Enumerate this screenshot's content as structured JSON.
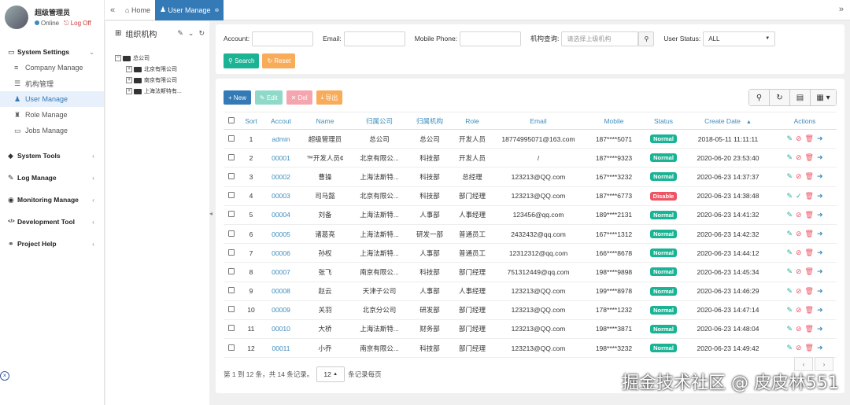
{
  "user": {
    "name": "超级管理员",
    "online": "Online",
    "logoff": "Log Off"
  },
  "menu": [
    {
      "label": "System Settings",
      "icon": "monitor-icon",
      "glyph": "▭",
      "arrow": "⌄"
    },
    {
      "label": "System Tools",
      "icon": "cube-icon",
      "glyph": "◆",
      "arrow": "‹"
    },
    {
      "label": "Log Manage",
      "icon": "edit-icon",
      "glyph": "✎",
      "arrow": "‹"
    },
    {
      "label": "Monitoring Manage",
      "icon": "eye-icon",
      "glyph": "◉",
      "arrow": "‹"
    },
    {
      "label": "Development Tool",
      "icon": "code-icon",
      "glyph": "</>",
      "arrow": "‹"
    },
    {
      "label": "Project Help",
      "icon": "link-icon",
      "glyph": "⚭",
      "arrow": "‹"
    }
  ],
  "submenu": [
    {
      "label": "Company Manage",
      "glyph": "≡"
    },
    {
      "label": "机构管理",
      "glyph": "☰"
    },
    {
      "label": "User Manage",
      "glyph": "♟"
    },
    {
      "label": "Role Manage",
      "glyph": "♜"
    },
    {
      "label": "Jobs Manage",
      "glyph": "▭"
    }
  ],
  "tabs": {
    "home": "Home",
    "active": "User Manage"
  },
  "tree": {
    "title": "组织机构",
    "root": "总公司",
    "children": [
      "北京有限公司",
      "南京有限公司",
      "上海法斯特有..."
    ]
  },
  "search": {
    "account_label": "Account:",
    "email_label": "Email:",
    "phone_label": "Mobile Phone:",
    "org_label": "机构查询:",
    "org_placeholder": "请选择上级机构",
    "status_label": "User Status:",
    "status_value": "ALL",
    "search_btn": "Search",
    "reset_btn": "Reset"
  },
  "toolbar": {
    "new": "New",
    "edit": "Edit",
    "del": "Del",
    "export": "导出"
  },
  "colors": {
    "primary": "#337ab7",
    "green": "#1ab394",
    "red": "#ed5565",
    "orange": "#f8ac59"
  },
  "table": {
    "headers": [
      "Sort",
      "Accout",
      "Name",
      "归属公司",
      "归属机构",
      "Role",
      "Email",
      "Mobile",
      "Status",
      "Create Date",
      "Actions"
    ],
    "sort_indicator": "▲",
    "rows": [
      {
        "sort": "1",
        "account": "admin",
        "name": "超级管理员",
        "company": "总公司",
        "dept": "总公司",
        "role": "开发人员",
        "email": "18774995071@163.com",
        "mobile": "187****5071",
        "status": "Normal",
        "date": "2018-05-11 11:11:11"
      },
      {
        "sort": "2",
        "account": "00001",
        "name": "™开发人员¢",
        "company": "北京有限公...",
        "dept": "科技部",
        "role": "开发人员",
        "email": "/",
        "mobile": "187****9323",
        "status": "Normal",
        "date": "2020-06-20 23:53:40"
      },
      {
        "sort": "3",
        "account": "00002",
        "name": "曹操",
        "company": "上海法斯特...",
        "dept": "科技部",
        "role": "总经理",
        "email": "123213@QQ.com",
        "mobile": "167****3232",
        "status": "Normal",
        "date": "2020-06-23 14:37:37"
      },
      {
        "sort": "4",
        "account": "00003",
        "name": "司马懿",
        "company": "北京有限公...",
        "dept": "科技部",
        "role": "部门经理",
        "email": "123213@QQ.com",
        "mobile": "187****6773",
        "status": "Disable",
        "date": "2020-06-23 14:38:48"
      },
      {
        "sort": "5",
        "account": "00004",
        "name": "刘备",
        "company": "上海法斯特...",
        "dept": "人事部",
        "role": "人事经理",
        "email": "123456@qq.com",
        "mobile": "189****2131",
        "status": "Normal",
        "date": "2020-06-23 14:41:32"
      },
      {
        "sort": "6",
        "account": "00005",
        "name": "诸葛亮",
        "company": "上海法斯特...",
        "dept": "研发一部",
        "role": "普通员工",
        "email": "2432432@qq.com",
        "mobile": "167****1312",
        "status": "Normal",
        "date": "2020-06-23 14:42:32"
      },
      {
        "sort": "7",
        "account": "00006",
        "name": "孙权",
        "company": "上海法斯特...",
        "dept": "人事部",
        "role": "普通员工",
        "email": "12312312@qq.com",
        "mobile": "166****8678",
        "status": "Normal",
        "date": "2020-06-23 14:44:12"
      },
      {
        "sort": "8",
        "account": "00007",
        "name": "张飞",
        "company": "南京有限公...",
        "dept": "科技部",
        "role": "部门经理",
        "email": "751312449@qq.com",
        "mobile": "198****9898",
        "status": "Normal",
        "date": "2020-06-23 14:45:34"
      },
      {
        "sort": "9",
        "account": "00008",
        "name": "赵云",
        "company": "天津子公司",
        "dept": "人事部",
        "role": "人事经理",
        "email": "123213@QQ.com",
        "mobile": "199****8978",
        "status": "Normal",
        "date": "2020-06-23 14:46:29"
      },
      {
        "sort": "10",
        "account": "00009",
        "name": "关羽",
        "company": "北京分公司",
        "dept": "研发部",
        "role": "部门经理",
        "email": "123213@QQ.com",
        "mobile": "178****1232",
        "status": "Normal",
        "date": "2020-06-23 14:47:14"
      },
      {
        "sort": "11",
        "account": "00010",
        "name": "大桥",
        "company": "上海法斯特...",
        "dept": "财务部",
        "role": "部门经理",
        "email": "123213@QQ.com",
        "mobile": "198****3871",
        "status": "Normal",
        "date": "2020-06-23 14:48:04"
      },
      {
        "sort": "12",
        "account": "00011",
        "name": "小乔",
        "company": "南京有限公...",
        "dept": "科技部",
        "role": "部门经理",
        "email": "123213@QQ.com",
        "mobile": "198****3232",
        "status": "Normal",
        "date": "2020-06-23 14:49:42"
      }
    ]
  },
  "pager": {
    "summary": "第 1 到 12 条，共 14 条记录。",
    "page_size": "12",
    "per_page": "条记录每页"
  },
  "watermark": "掘金技术社区 @ 皮皮林551"
}
